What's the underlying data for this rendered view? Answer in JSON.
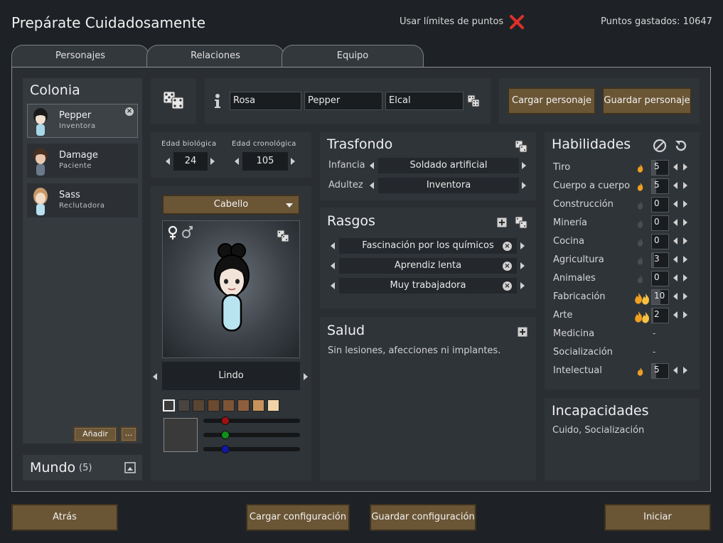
{
  "header": {
    "title": "Prepárate Cuidadosamente",
    "point_limits_label": "Usar límites de puntos",
    "points_spent": "Puntos gastados: 10647"
  },
  "tabs": [
    {
      "label": "Personajes"
    },
    {
      "label": "Relaciones"
    },
    {
      "label": "Equipo"
    }
  ],
  "colony": {
    "title": "Colonia",
    "pawns": [
      {
        "name": "Pepper",
        "role": "Inventora",
        "selected": true
      },
      {
        "name": "Damage",
        "role": "Paciente",
        "selected": false
      },
      {
        "name": "Sass",
        "role": "Reclutadora",
        "selected": false
      }
    ],
    "add_label": "Añadir",
    "more_label": "..."
  },
  "world": {
    "title": "Mundo",
    "count": "(5)"
  },
  "name": {
    "first": "Rosa",
    "nick": "Pepper",
    "last": "Elcal"
  },
  "buttons": {
    "load_character": "Cargar personaje",
    "save_character": "Guardar personaje",
    "back": "Atrás",
    "load_config": "Cargar configuración",
    "save_config": "Guardar configuración",
    "start": "Iniciar"
  },
  "age": {
    "bio_label": "Edad biológica",
    "bio_value": "24",
    "chrono_label": "Edad cronológica",
    "chrono_value": "105"
  },
  "appearance": {
    "hair_dropdown": "Cabello",
    "body_type": "Lindo",
    "skin_colors": [
      "#3a3a3a",
      "#4a4440",
      "#5a4533",
      "#6b4a30",
      "#7d5436",
      "#8e5e3c",
      "#c8935a",
      "#f0d4a8"
    ]
  },
  "background": {
    "title": "Trasfondo",
    "childhood_label": "Infancia",
    "childhood_value": "Soldado artificial",
    "adulthood_label": "Adultez",
    "adulthood_value": "Inventora"
  },
  "traits": {
    "title": "Rasgos",
    "items": [
      "Fascinación por los químicos",
      "Aprendiz lenta",
      "Muy trabajadora"
    ]
  },
  "health": {
    "title": "Salud",
    "text": "Sin lesiones, afecciones ni implantes."
  },
  "skills": {
    "title": "Habilidades",
    "items": [
      {
        "name": "Tiro",
        "passion": 1,
        "value": "5"
      },
      {
        "name": "Cuerpo a cuerpo",
        "passion": 1,
        "value": "5"
      },
      {
        "name": "Construcción",
        "passion": 0,
        "value": "0"
      },
      {
        "name": "Minería",
        "passion": 0,
        "value": "0"
      },
      {
        "name": "Cocina",
        "passion": 0,
        "value": "0"
      },
      {
        "name": "Agricultura",
        "passion": 0,
        "value": "3"
      },
      {
        "name": "Animales",
        "passion": 0,
        "value": "0"
      },
      {
        "name": "Fabricación",
        "passion": 2,
        "value": "10"
      },
      {
        "name": "Arte",
        "passion": 2,
        "value": "2"
      },
      {
        "name": "Medicina",
        "passion": -1,
        "value": "-"
      },
      {
        "name": "Socialización",
        "passion": -1,
        "value": "-"
      },
      {
        "name": "Intelectual",
        "passion": 1,
        "value": "5"
      }
    ]
  },
  "incapable": {
    "title": "Incapacidades",
    "text": "Cuido, Socialización"
  }
}
